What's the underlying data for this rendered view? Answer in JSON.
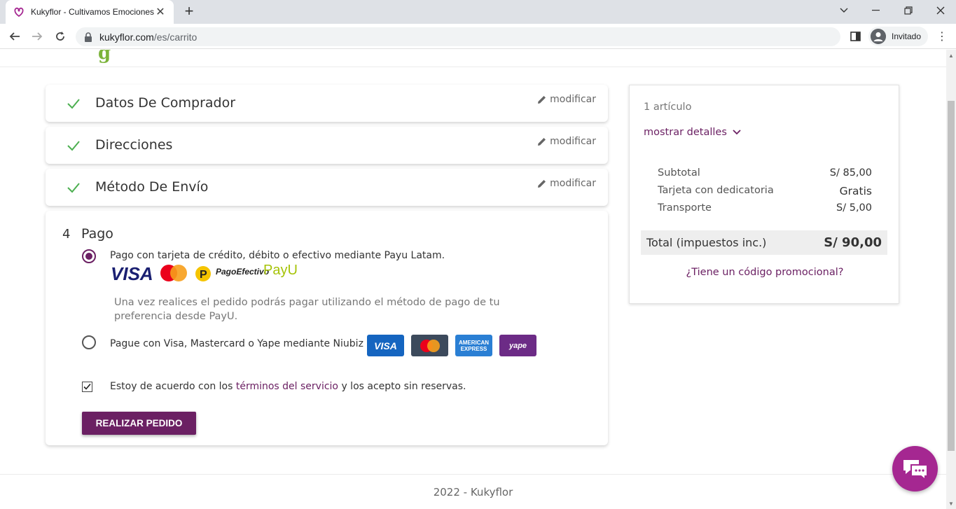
{
  "browser": {
    "tab_title": "Kukyflor - Cultivamos Emociones",
    "url_host": "kukyflor.com",
    "url_path": "/es/carrito",
    "profile_label": "Invitado"
  },
  "checkout": {
    "steps": [
      {
        "title": "Datos De Comprador",
        "edit_label": "modificar"
      },
      {
        "title": "Direcciones",
        "edit_label": "modificar"
      },
      {
        "title": "Método De Envío",
        "edit_label": "modificar"
      }
    ],
    "payment": {
      "number": "4",
      "title": "Pago",
      "option_payu": {
        "label": "Pago con tarjeta de crédito, débito o efectivo mediante Payu Latam.",
        "description": "Una vez realices el pedido podrás pagar utilizando el método de pago de tu preferencia desde PayU.",
        "selected": true,
        "brands": {
          "visa": "VISA",
          "pagoefectivo": "PagoEfectivo",
          "payu": "PayU"
        }
      },
      "option_niubiz": {
        "label": "Pague con Visa, Mastercard o Yape mediante Niubiz",
        "selected": false,
        "cards": {
          "visa": "VISA",
          "amex_line1": "AMERICAN",
          "amex_line2": "EXPRESS",
          "yape": "yape"
        }
      },
      "terms_before": "Estoy de acuerdo con los ",
      "terms_link": "términos del servicio",
      "terms_after": " y los acepto sin reservas.",
      "terms_checked": true,
      "place_order_label": "REALIZAR PEDIDO"
    }
  },
  "summary": {
    "items_count": "1 artículo",
    "show_details": "mostrar detalles",
    "lines": [
      {
        "label": "Subtotal",
        "value": "S/ 85,00"
      },
      {
        "label": "Tarjeta con dedicatoria",
        "value": "Gratis"
      },
      {
        "label": "Transporte",
        "value": "S/ 5,00"
      }
    ],
    "total_label": "Total (impuestos inc.)",
    "total_value": "S/ 90,00",
    "promo_label": "¿Tiene un código promocional?"
  },
  "footer": {
    "text": "2022 - Kukyflor"
  },
  "colors": {
    "accent": "#6b2063",
    "check": "#4caf50",
    "chat": "#a52791"
  }
}
